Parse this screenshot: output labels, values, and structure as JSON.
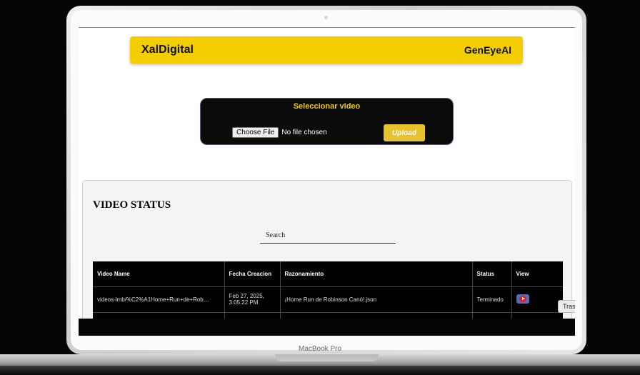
{
  "device": {
    "model_label": "MacBook Pro"
  },
  "header": {
    "brand": "XalDigital",
    "product": "GenEyeAI"
  },
  "upload": {
    "title": "Seleccionar video",
    "choose_label": "Choose File",
    "file_status": "No file chosen",
    "upload_label": "Upload"
  },
  "status": {
    "title": "VIDEO STATUS",
    "search_placeholder": "Search",
    "columns": [
      "Video Name",
      "Fecha Creacion",
      "Razonamiento",
      "Status",
      "View"
    ],
    "rows": [
      {
        "video_name": "videos-lmb/%C2%A1Home+Run+de+Rob…",
        "fecha": "Feb 27, 2025, 3:05:22 PM",
        "razonamiento": "¡Home Run de Robinson Canó!.json",
        "status": "Terminado",
        "view_icon": "play-video-icon"
      }
    ]
  },
  "floating": {
    "tras_label": "Tras"
  },
  "colors": {
    "brand_yellow": "#f2cd00",
    "upload_button": "#e8c22c",
    "table_bg": "#000000"
  }
}
